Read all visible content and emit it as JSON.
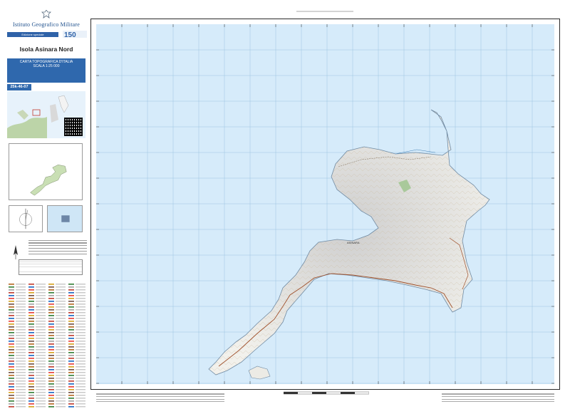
{
  "publisher": {
    "name": "Istituto Geografico Militare",
    "edition": "Edizione speciale"
  },
  "map": {
    "title": "Isola Asinara Nord",
    "series": "CARTA TOPOGRAFICA D'ITALIA",
    "scale": "SCALA 1:25 000",
    "sheet_code": "25k-46-07",
    "place_label": "ASINARA"
  },
  "colors": {
    "water": "#d6ebfa",
    "land": "#f6f5ef",
    "brand_blue": "#2f68ad",
    "frame": "#2a2a2a"
  },
  "icons": [
    "emblem-icon",
    "anniversary-logo-icon",
    "qr-code-icon",
    "north-arrow-icon"
  ]
}
